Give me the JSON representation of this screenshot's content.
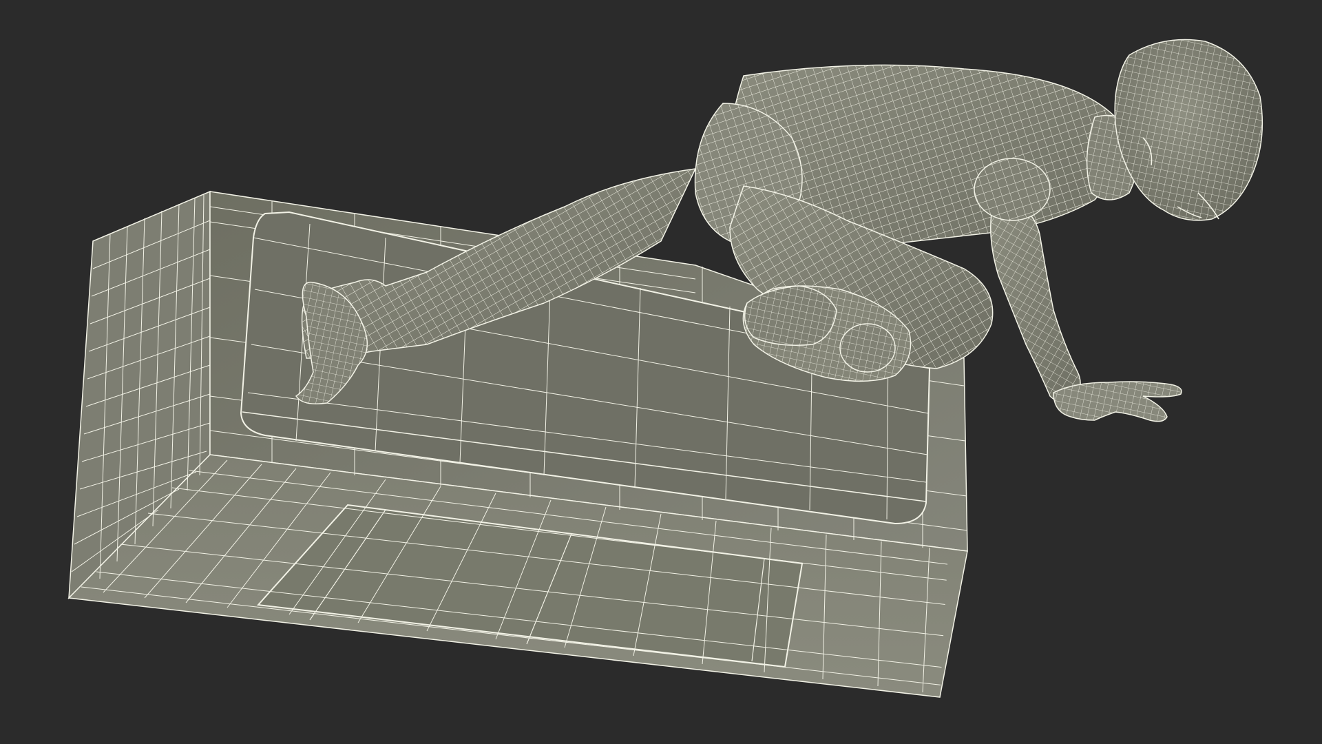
{
  "scene": {
    "subject": "wireframe-figure-on-block",
    "colors": {
      "background": "#2b2b2b",
      "model_fill": "#7c7d6e",
      "model_shadow": "#5f6055",
      "model_light": "#8e8f80",
      "wireframe": "#f2f2e6"
    }
  }
}
